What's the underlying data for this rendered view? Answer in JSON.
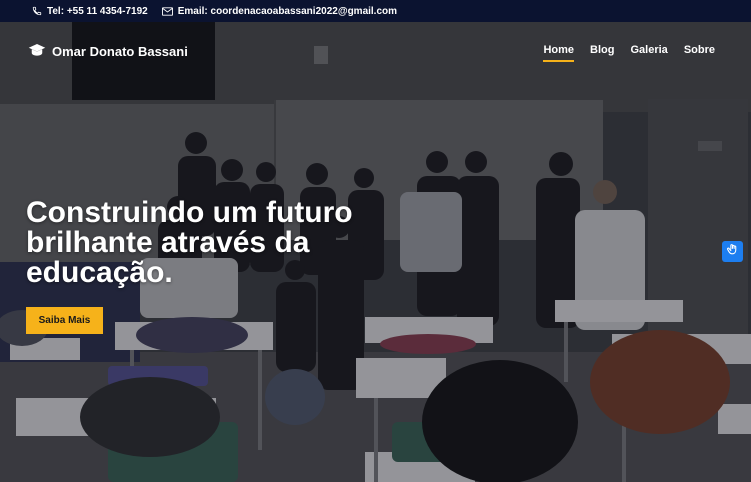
{
  "topbar": {
    "phone": "Tel: +55 11 4354-7192",
    "email": "Email: coordenacaoabassani2022@gmail.com",
    "phone_icon": "phone-icon",
    "email_icon": "envelope-icon"
  },
  "header": {
    "brand": "Omar Donato Bassani",
    "brand_icon": "graduation-cap-icon",
    "menu": [
      {
        "label": "Home",
        "active": true
      },
      {
        "label": "Blog",
        "active": false
      },
      {
        "label": "Galeria",
        "active": false
      },
      {
        "label": "Sobre",
        "active": false
      }
    ]
  },
  "hero": {
    "headline_lines": [
      "Construindo um futuro",
      "brilhante através da",
      "educação."
    ],
    "cta_label": "Saiba Mais"
  },
  "accessibility": {
    "icon": "accessibility-hand-icon"
  },
  "colors": {
    "topbar_bg": "#0b1330",
    "accent": "#f6b21a",
    "a11y_button": "#1d7ef0"
  }
}
